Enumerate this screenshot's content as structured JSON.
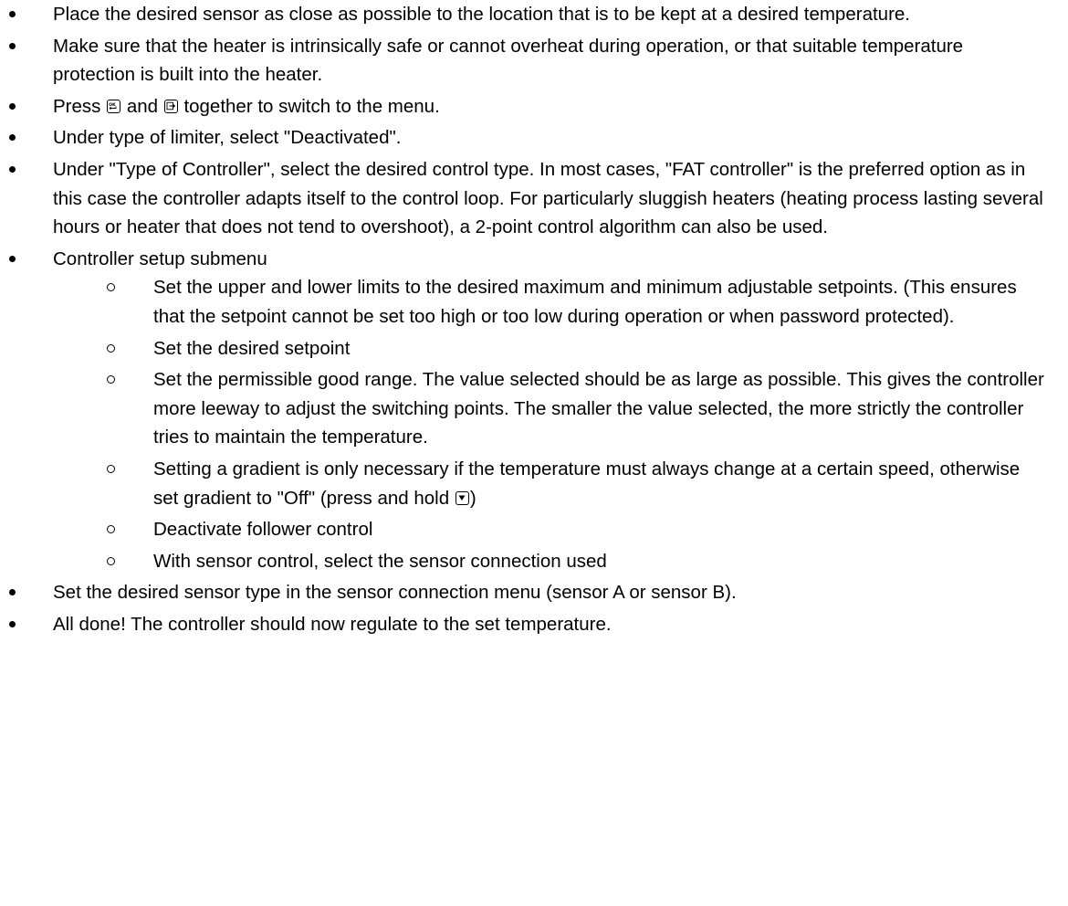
{
  "steps": [
    {
      "text": "Place the desired sensor as close as possible to the location that is to be kept at a desired temperature."
    },
    {
      "text": "Make sure that the heater is intrinsically safe or cannot overheat during operation, or that suitable temperature protection is built into the heater."
    },
    {
      "pre": "Press",
      "mid": "and",
      "post": "together to switch to the menu.",
      "icon1": "ok-key-icon",
      "icon2": "exit-key-icon"
    },
    {
      "text": "Under type of limiter, select \"Deactivated\"."
    },
    {
      "text": "Under \"Type of Controller\", select the desired control type. In most cases, \"FAT controller\" is the preferred option as in this case the controller adapts itself to the control loop. For particularly sluggish heaters (heating process lasting several hours or heater that does not tend to overshoot), a 2-point control algorithm can also be used."
    },
    {
      "text": "Controller setup submenu"
    },
    {
      "text": "Set the desired sensor type in the sensor connection menu (sensor A or sensor B)."
    },
    {
      "text": "All done! The controller should now regulate to the set temperature."
    }
  ],
  "substeps": [
    {
      "text": "Set the upper and lower limits to the desired maximum and minimum adjustable setpoints. (This ensures that the setpoint cannot be set too high or too low during operation or when password protected)."
    },
    {
      "text": "Set the desired setpoint"
    },
    {
      "text": "Set the permissible good range. The value selected should be as large as possible. This gives the controller more leeway to adjust the switching points. The smaller the value selected, the more strictly the controller tries to maintain the temperature."
    },
    {
      "pre": "Setting a gradient is only necessary if the temperature must always change at a certain speed, otherwise set gradient to \"Off\" (press and hold",
      "post": ")",
      "icon": "down-arrow-key-icon"
    },
    {
      "text": "Deactivate follower control"
    },
    {
      "text": "With sensor control, select the sensor connection used"
    }
  ]
}
